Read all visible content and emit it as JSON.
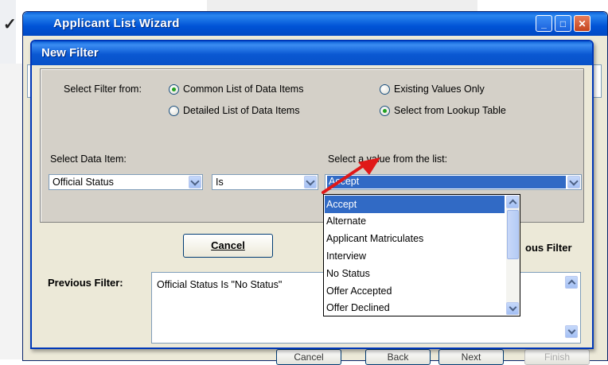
{
  "outer_window": {
    "title": "Applicant List Wizard",
    "checkmark": "✓",
    "buttons": [
      "Cancel",
      "Back",
      "Next",
      "Finish"
    ]
  },
  "dialog": {
    "title": "New Filter",
    "select_filter_from_label": "Select Filter from:",
    "radio_options": [
      {
        "label": "Common List of Data Items",
        "selected": true
      },
      {
        "label": "Detailed List of Data Items",
        "selected": false
      },
      {
        "label": "Existing Values Only",
        "selected": false
      },
      {
        "label": "Select from Lookup Table",
        "selected": true
      }
    ],
    "select_data_item_label": "Select Data Item:",
    "data_item_value": "Official Status",
    "operator_value": "Is",
    "select_value_label": "Select a value from the list:",
    "value_selected": "Accept",
    "value_options": [
      "Accept",
      "Alternate",
      "Applicant Matriculates",
      "Interview",
      "No Status",
      "Offer Accepted",
      "Offer Declined"
    ],
    "cancel_button": "Cancel",
    "previous_filter_heading": "ous Filter",
    "previous_filter_label": "Previous Filter:",
    "previous_filter_text": "Official Status Is \"No Status\""
  },
  "colors": {
    "titlebar": "#0a58d2",
    "selection": "#316ac5",
    "arrow": "#e01818",
    "dialog_bg": "#ece9d8",
    "panel_bg": "#d4d0c8"
  }
}
